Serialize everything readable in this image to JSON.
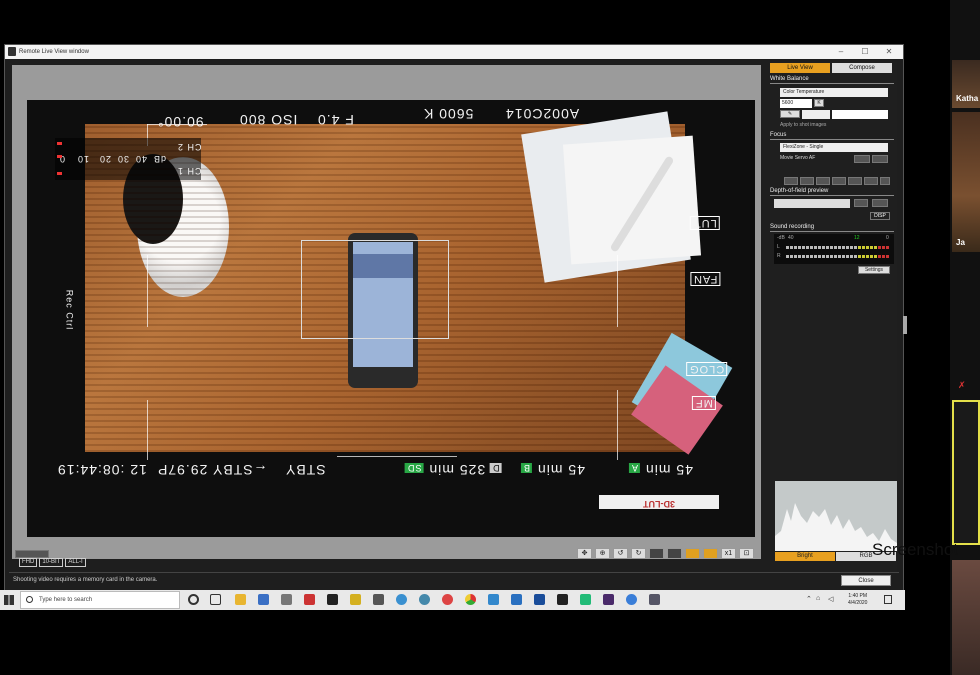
{
  "window": {
    "title": "Remote Live View window",
    "controls": [
      "–",
      "☐",
      "✕"
    ]
  },
  "liveview": {
    "osd_top": {
      "id": "A002C014",
      "kelvin": "5600 K",
      "fstop": "F 4.0",
      "iso": "ISO 800",
      "shutter": "90.00°"
    },
    "osd_bottom": {
      "tc": "12 :08:44:19",
      "stby_fps": "←STBY 29.97P",
      "stby": "STBY",
      "card_d": "325 min",
      "card_b": "45 min",
      "card_a": "45 min",
      "card_d_badge": "D",
      "card_b_badge": "B",
      "card_a_badge": "A"
    },
    "osd_right": [
      "LUT",
      "FAN",
      "CLOG",
      "MF"
    ],
    "osd_left": "Rec Ctrl",
    "vu": {
      "ch1": "CH 1",
      "ch2": "CH 2",
      "scale_label": "dB",
      "scale": [
        "0",
        "10",
        "20",
        "30",
        "40",
        "8"
      ]
    },
    "lut_label": "3D-LUT",
    "bottom_left_buttons": [
      "FHD",
      "10-BIT",
      "ALL-I"
    ]
  },
  "statusbar": {
    "message": "Shooting video requires a memory card in the camera."
  },
  "close_button": "Close",
  "panel": {
    "tabs": [
      "Live View",
      "Compose"
    ],
    "white_balance": {
      "heading": "White Balance",
      "mode": "Color Temperature",
      "kelvin": "5600",
      "unit": "K",
      "apply_label": "Apply to shot images"
    },
    "focus": {
      "heading": "Focus",
      "mode": "FlexiZone - Single",
      "servo_label": "Movie Servo AF"
    },
    "dof": {
      "heading": "Depth-of-field preview",
      "button": "DISP"
    },
    "sound": {
      "heading": "Sound recording",
      "scale": [
        "-dB",
        "40",
        "12",
        "0"
      ],
      "left": "L",
      "right": "R",
      "settings": "Settings"
    },
    "histogram": {
      "bright": "Bright",
      "rgb": "RGB"
    }
  },
  "taskbar": {
    "search_placeholder": "Type here to search",
    "time": "1:40 PM",
    "date": "4/4/2020"
  },
  "video_strip": {
    "name1": "Katha",
    "name2": "Ja"
  },
  "overlay_text": "Screenshot"
}
